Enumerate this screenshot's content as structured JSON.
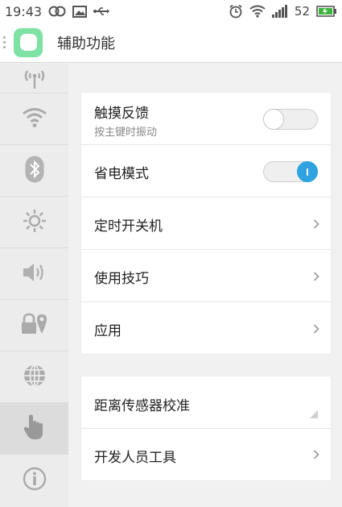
{
  "status_bar": {
    "time": "19:43",
    "battery_level": "52",
    "icons": [
      "link-icon",
      "image-icon",
      "usb-icon",
      "alarm-icon",
      "wifi-icon",
      "signal-icon",
      "battery-icon"
    ]
  },
  "header": {
    "title": "辅助功能"
  },
  "sidebar": {
    "items": [
      {
        "name": "antenna-icon"
      },
      {
        "name": "wifi-icon"
      },
      {
        "name": "bluetooth-icon"
      },
      {
        "name": "brightness-icon"
      },
      {
        "name": "volume-icon"
      },
      {
        "name": "lock-location-icon"
      },
      {
        "name": "globe-icon"
      },
      {
        "name": "hand-touch-icon",
        "active": true
      },
      {
        "name": "info-icon"
      }
    ]
  },
  "settings": {
    "group1": [
      {
        "label": "触摸反馈",
        "sub": "按主键时振动",
        "control": "toggle",
        "value": false
      },
      {
        "label": "省电模式",
        "control": "toggle",
        "value": true
      },
      {
        "label": "定时开关机",
        "control": "chevron"
      },
      {
        "label": "使用技巧",
        "control": "chevron"
      },
      {
        "label": "应用",
        "control": "chevron"
      }
    ],
    "group2": [
      {
        "label": "距离传感器校准",
        "control": "corner"
      },
      {
        "label": "开发人员工具",
        "control": "chevron"
      }
    ]
  },
  "colors": {
    "accent": "#2ea3e0",
    "battery": "#3cb43c",
    "app_icon": "#7ee2a4",
    "sidebar_bg": "#ececec",
    "page_bg": "#f1f1f1"
  }
}
